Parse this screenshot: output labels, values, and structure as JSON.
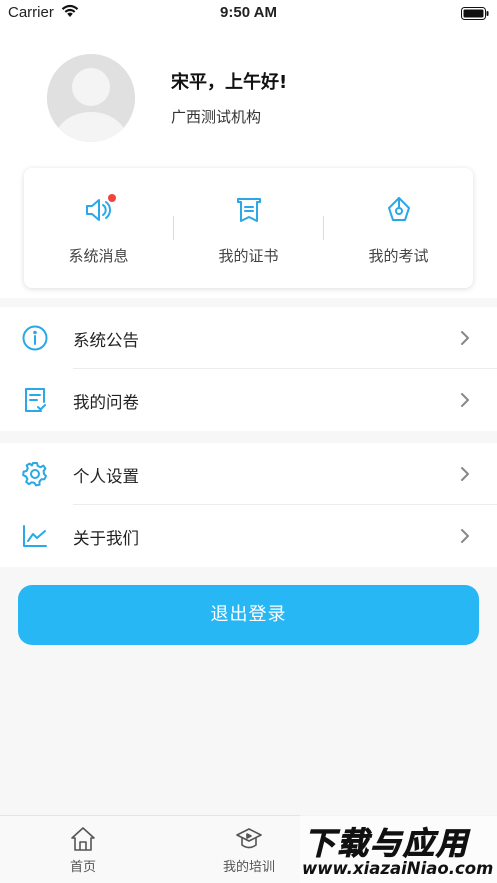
{
  "status_bar": {
    "carrier": "Carrier",
    "time": "9:50 AM"
  },
  "profile": {
    "greeting": "宋平，上午好!",
    "organization": "广西测试机构"
  },
  "quick_actions": [
    {
      "label": "系统消息",
      "icon": "speaker-icon",
      "has_badge": true
    },
    {
      "label": "我的证书",
      "icon": "certificate-icon",
      "has_badge": false
    },
    {
      "label": "我的考试",
      "icon": "pen-nib-icon",
      "has_badge": false
    }
  ],
  "menu_group_1": [
    {
      "label": "系统公告",
      "icon": "info-circle-icon"
    },
    {
      "label": "我的问卷",
      "icon": "questionnaire-icon"
    }
  ],
  "menu_group_2": [
    {
      "label": "个人设置",
      "icon": "gear-icon"
    },
    {
      "label": "关于我们",
      "icon": "line-chart-icon"
    }
  ],
  "logout": {
    "label": "退出登录"
  },
  "tab_bar": [
    {
      "label": "首页",
      "icon": "home-icon"
    },
    {
      "label": "我的培训",
      "icon": "graduation-cap-icon"
    }
  ],
  "watermark": {
    "title": "下载与应用",
    "url": "www.xiazaiNiao.com"
  },
  "colors": {
    "accent": "#27b7f5",
    "badge": "#f0443c",
    "icon": "#2aa8e8"
  }
}
